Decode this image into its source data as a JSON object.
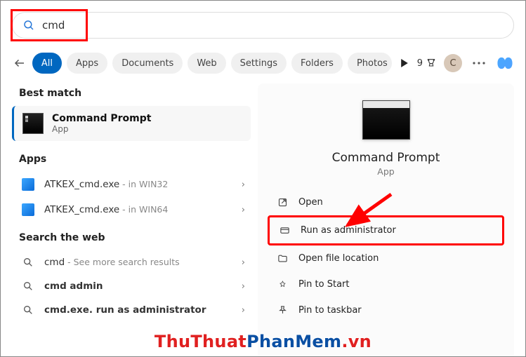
{
  "search": {
    "query": "cmd"
  },
  "filters": {
    "back": "←",
    "pills": [
      "All",
      "Apps",
      "Documents",
      "Web",
      "Settings",
      "Folders",
      "Photos"
    ],
    "active_index": 0,
    "points": "9",
    "avatar_initial": "C"
  },
  "left": {
    "best_match_head": "Best match",
    "best_match": {
      "title": "Command Prompt",
      "subtitle": "App"
    },
    "apps_head": "Apps",
    "apps": [
      {
        "name": "ATKEX_cmd.exe",
        "suffix": " - in WIN32"
      },
      {
        "name": "ATKEX_cmd.exe",
        "suffix": " - in WIN64"
      }
    ],
    "web_head": "Search the web",
    "web": [
      {
        "name": "cmd",
        "suffix": " - See more search results"
      },
      {
        "name": "cmd admin",
        "suffix": ""
      },
      {
        "name": "cmd.exe. run as administrator",
        "suffix": ""
      }
    ]
  },
  "right": {
    "title": "Command Prompt",
    "subtitle": "App",
    "actions": [
      {
        "key": "open",
        "label": "Open"
      },
      {
        "key": "run-admin",
        "label": "Run as administrator"
      },
      {
        "key": "file-loc",
        "label": "Open file location"
      },
      {
        "key": "pin-start",
        "label": "Pin to Start"
      },
      {
        "key": "pin-taskbar",
        "label": "Pin to taskbar"
      }
    ]
  },
  "watermark": {
    "a": "ThuThuat",
    "b": "PhanMem",
    "c": ".vn"
  },
  "annotation": {
    "highlight_color": "#ff0000"
  }
}
